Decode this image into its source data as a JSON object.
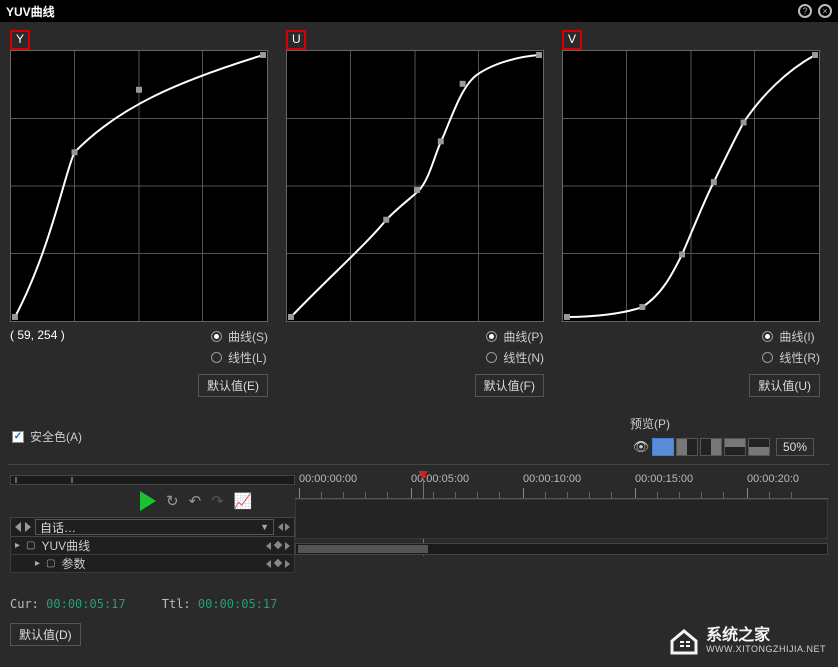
{
  "panel": {
    "title": "YUV曲线"
  },
  "curves": {
    "labels": {
      "y": "Y",
      "u": "U",
      "v": "V"
    },
    "coord_readout": "( 59, 254 )",
    "radio_curve_s": "曲线(S)",
    "radio_linear_l": "线性(L)",
    "radio_curve_p": "曲线(P)",
    "radio_linear_n": "线性(N)",
    "radio_curve_i": "曲线(I)",
    "radio_linear_r": "线性(R)",
    "default_e": "默认值(E)",
    "default_f": "默认值(F)",
    "default_u": "默认值(U)"
  },
  "safe_color": {
    "label": "安全色(A)",
    "checked": true
  },
  "preview": {
    "label": "预览(P)",
    "zoom": "50%"
  },
  "timeline": {
    "dropdown": "自话…",
    "track1": "YUV曲线",
    "track2": "参数",
    "ruler": [
      "00:00:00:00",
      "00:00:05:00",
      "00:00:10:00",
      "00:00:15:00",
      "00:00:20:0"
    ],
    "cur_label": "Cur:",
    "cur_value": "00:00:05:17",
    "ttl_label": "Ttl:",
    "ttl_value": "00:00:05:17"
  },
  "bottom_default": "默认值(D)",
  "watermark": {
    "main": "系统之家",
    "sub": "WWW.XITONGZHIJIA.NET"
  },
  "chart_data": [
    {
      "type": "line",
      "title": "Y curve",
      "xlim": [
        0,
        255
      ],
      "ylim": [
        0,
        255
      ],
      "points": [
        [
          0,
          0
        ],
        [
          64,
          160
        ],
        [
          128,
          220
        ],
        [
          255,
          255
        ]
      ]
    },
    {
      "type": "line",
      "title": "U curve",
      "xlim": [
        0,
        255
      ],
      "ylim": [
        0,
        255
      ],
      "points": [
        [
          0,
          0
        ],
        [
          100,
          95
        ],
        [
          130,
          125
        ],
        [
          155,
          175
        ],
        [
          175,
          230
        ],
        [
          255,
          255
        ]
      ]
    },
    {
      "type": "line",
      "title": "V curve",
      "xlim": [
        0,
        255
      ],
      "ylim": [
        0,
        255
      ],
      "points": [
        [
          0,
          0
        ],
        [
          80,
          10
        ],
        [
          120,
          60
        ],
        [
          150,
          130
        ],
        [
          180,
          190
        ],
        [
          255,
          255
        ]
      ]
    }
  ]
}
